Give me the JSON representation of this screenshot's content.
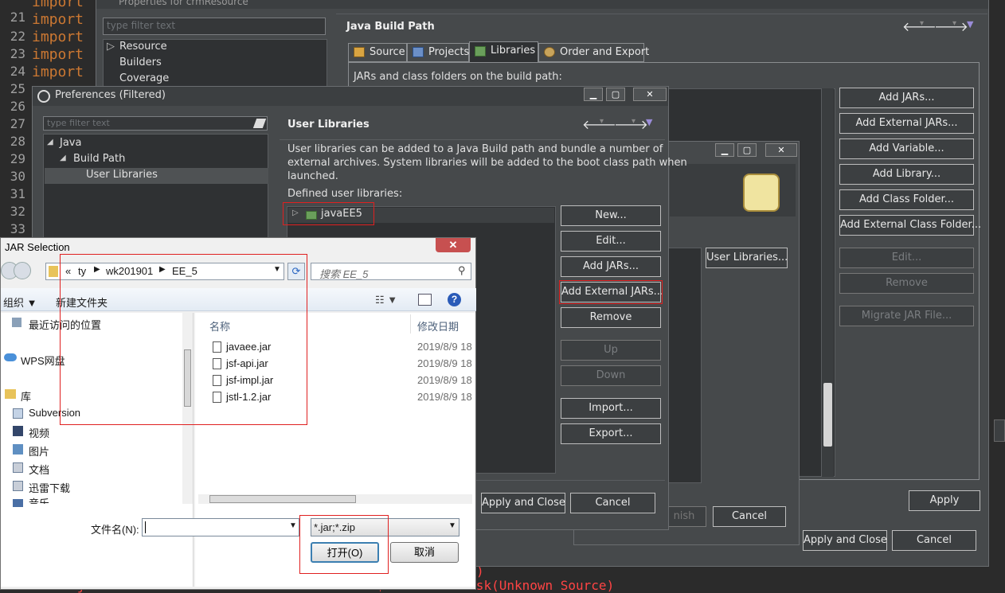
{
  "editor": {
    "line_numbers": [
      "21",
      "22",
      "23",
      "24",
      "25",
      "26",
      "27",
      "28",
      "29",
      "30",
      "31",
      "32",
      "33"
    ],
    "import_keyword": "import",
    "error_line": "at java.util.concurrent.ThreadPoolExecutor$Worker.runTask(Unknown Source)",
    "error_line_partial": ")"
  },
  "properties_dialog": {
    "title": "Properties for crmResource",
    "filter_placeholder": "type filter text",
    "tree": [
      "Resource",
      "Builders",
      "Coverage"
    ],
    "heading": "Java Build Path",
    "tabs": [
      "Source",
      "Projects",
      "Libraries",
      "Order and Export"
    ],
    "active_tab": "Libraries",
    "list_label": "JARs and class folders on the build path:",
    "buttons": [
      "Add JARs...",
      "Add External JARs...",
      "Add Variable...",
      "Add Library...",
      "Add Class Folder...",
      "Add External Class Folder..."
    ],
    "disabled_buttons": [
      "Edit...",
      "Remove",
      "Migrate JAR File..."
    ],
    "apply": "Apply",
    "apply_and_close": "Apply and Close",
    "cancel": "Cancel"
  },
  "middle_dialog": {
    "user_libraries_button": "User Libraries...",
    "finish": "nish",
    "cancel": "Cancel"
  },
  "preferences_dialog": {
    "title": "Preferences (Filtered)",
    "filter_placeholder": "type filter text",
    "tree": {
      "java": "Java",
      "build_path": "Build Path",
      "user_libraries": "User Libraries"
    },
    "heading": "User Libraries",
    "description": [
      "User libraries can be added to a Java Build path and bundle a number of",
      "external archives. System libraries will be added to the boot class path when",
      "launched."
    ],
    "defined_label": "Defined user libraries:",
    "library_item": "javaEE5",
    "buttons": [
      "New...",
      "Edit...",
      "Add JARs...",
      "Add External JARs...",
      "Remove"
    ],
    "disabled_buttons": [
      "Up",
      "Down"
    ],
    "buttons_lower": [
      "Import...",
      "Export..."
    ],
    "apply_and_close": "Apply and Close",
    "cancel": "Cancel"
  },
  "jar_dialog": {
    "title": "JAR Selection",
    "breadcrumb": [
      "«",
      "ty",
      "wk201901",
      "EE_5"
    ],
    "search_placeholder": "搜索 EE_5",
    "organize": "组织 ▼",
    "new_folder": "新建文件夹",
    "nav_items": [
      "最近访问的位置",
      "WPS网盘",
      "库",
      "Subversion",
      "视频",
      "图片",
      "文档",
      "迅雷下载",
      "音乐"
    ],
    "col_name": "名称",
    "col_date": "修改日期",
    "files": [
      {
        "name": "javaee.jar",
        "date": "2019/8/9 18"
      },
      {
        "name": "jsf-api.jar",
        "date": "2019/8/9 18"
      },
      {
        "name": "jsf-impl.jar",
        "date": "2019/8/9 18"
      },
      {
        "name": "jstl-1.2.jar",
        "date": "2019/8/9 18"
      }
    ],
    "filename_label": "文件名(N):",
    "filename_value": "",
    "filter_value": "*.jar;*.zip",
    "open": "打开(O)",
    "cancel": "取消"
  }
}
